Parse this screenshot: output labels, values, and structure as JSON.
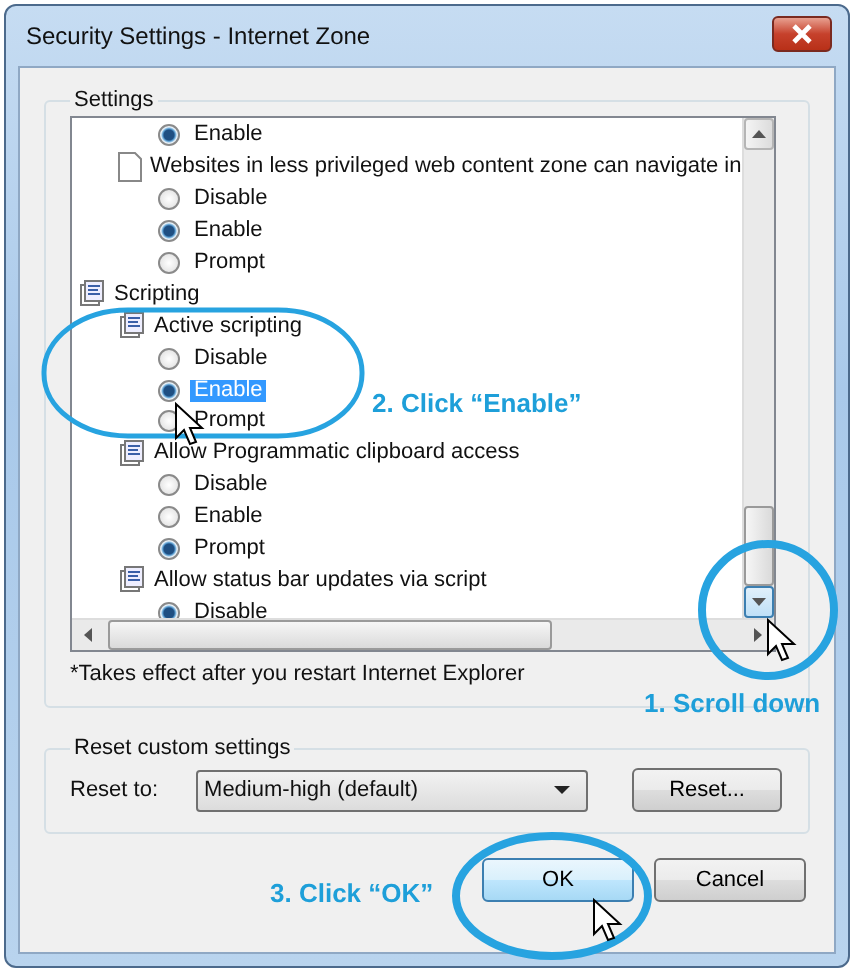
{
  "window": {
    "title": "Security Settings - Internet Zone"
  },
  "settings": {
    "label": "Settings",
    "categories": [
      {
        "children": [
          {
            "children": [
              {
                "label": "Enable",
                "selected": true,
                "highlighted": false
              }
            ]
          },
          {
            "label": "Websites in less privileged web content zone can navigate in",
            "kind": "page",
            "children": [
              {
                "label": "Disable",
                "selected": false,
                "highlighted": false
              },
              {
                "label": "Enable",
                "selected": true,
                "highlighted": false
              },
              {
                "label": "Prompt",
                "selected": false,
                "highlighted": false
              }
            ]
          }
        ]
      },
      {
        "label": "Scripting",
        "children": [
          {
            "label": "Active scripting",
            "kind": "script",
            "children": [
              {
                "label": "Disable",
                "selected": false,
                "highlighted": false
              },
              {
                "label": "Enable",
                "selected": true,
                "highlighted": true
              },
              {
                "label": "Prompt",
                "selected": false,
                "highlighted": false
              }
            ]
          },
          {
            "label": "Allow Programmatic clipboard access",
            "kind": "script",
            "children": [
              {
                "label": "Disable",
                "selected": false,
                "highlighted": false
              },
              {
                "label": "Enable",
                "selected": false,
                "highlighted": false
              },
              {
                "label": "Prompt",
                "selected": true,
                "highlighted": false
              }
            ]
          },
          {
            "label": "Allow status bar updates via script",
            "kind": "script",
            "children": [
              {
                "label": "Disable",
                "selected": true,
                "highlighted": false
              }
            ]
          }
        ]
      }
    ],
    "note": "*Takes effect after you restart Internet Explorer"
  },
  "reset": {
    "label": "Reset custom settings",
    "reset_to": "Reset to:",
    "dropdown": {
      "value": "Medium-high (default)"
    },
    "button": "Reset..."
  },
  "buttons": [
    {
      "label": "OK",
      "default": true
    },
    {
      "label": "Cancel",
      "default": false
    }
  ],
  "annotations": [
    {
      "text": "2. Click “Enable”"
    },
    {
      "text": "1. Scroll down"
    },
    {
      "text": "3. Click “OK”"
    }
  ]
}
